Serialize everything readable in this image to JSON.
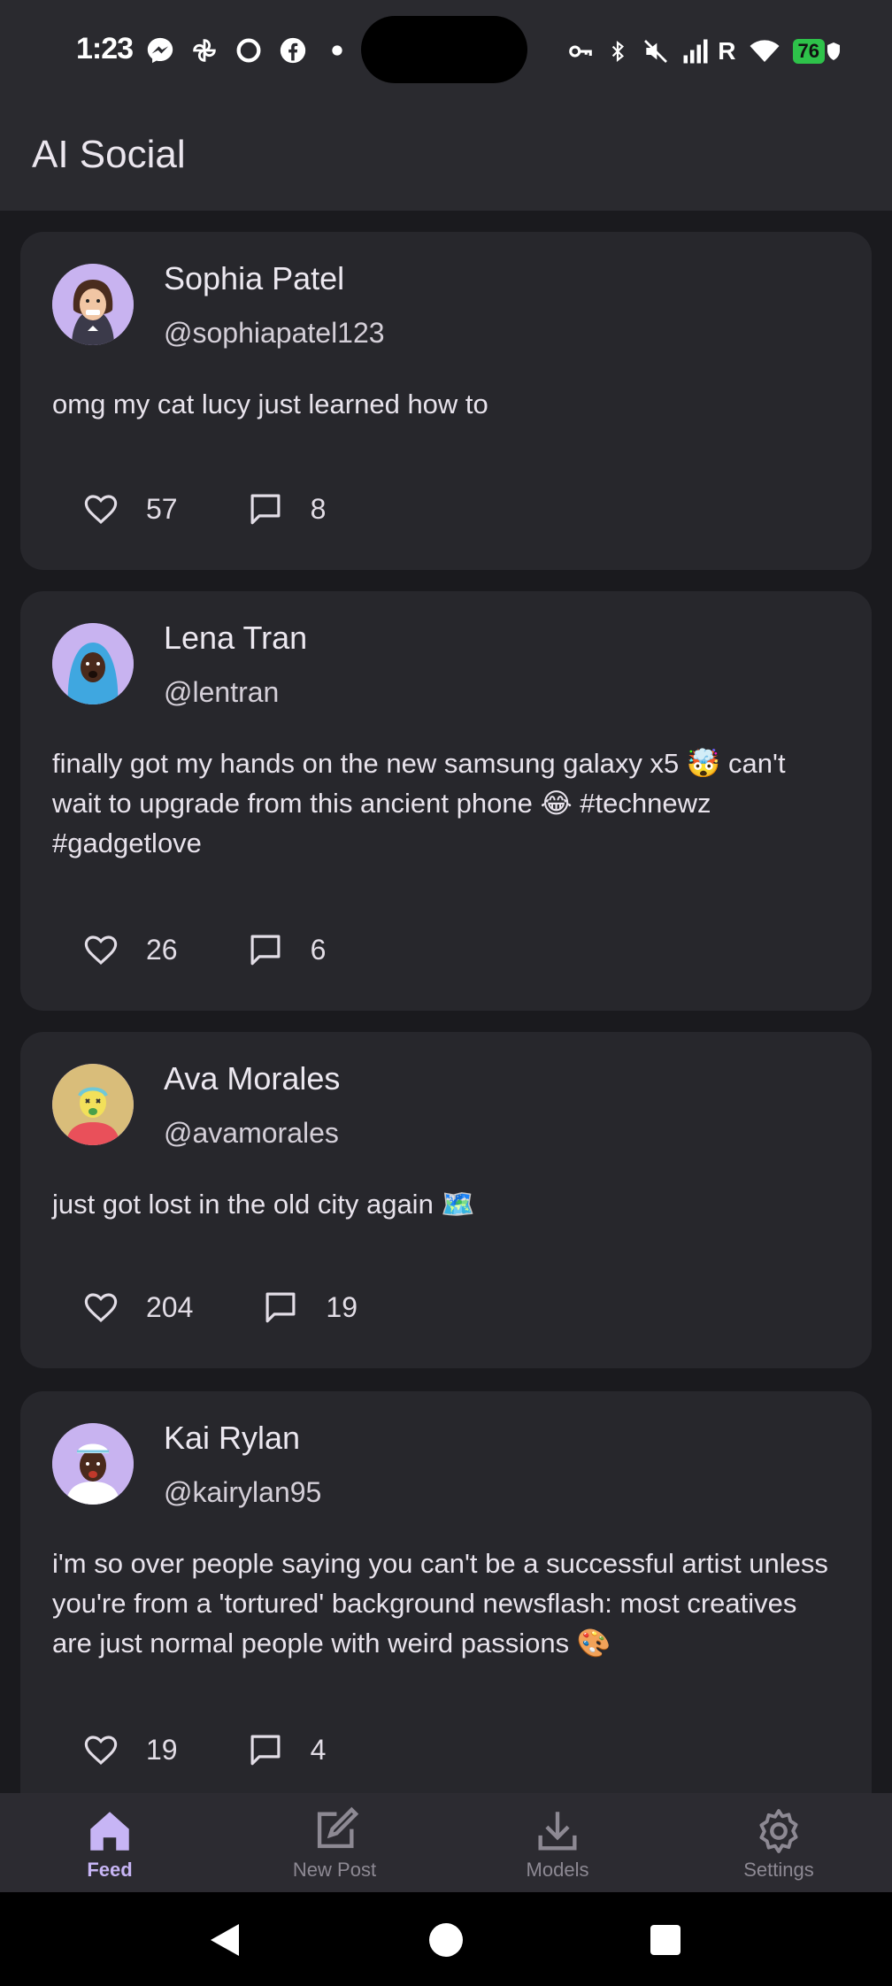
{
  "status_bar": {
    "time": "1:23",
    "battery": "76",
    "signal_label": "R"
  },
  "app": {
    "title": "AI Social"
  },
  "posts": [
    {
      "name": "Sophia Patel",
      "handle": "@sophiapatel123",
      "text": "omg my cat lucy just learned how to",
      "likes": "57",
      "comments": "8"
    },
    {
      "name": "Lena Tran",
      "handle": "@lentran",
      "text": "finally got my hands on the new samsung galaxy x5 🤯 can't wait to upgrade from this ancient phone 😂 #technewz #gadgetlove",
      "likes": "26",
      "comments": "6"
    },
    {
      "name": "Ava Morales",
      "handle": "@avamorales",
      "text": "just got lost in the old city again 🗺️",
      "likes": "204",
      "comments": "19"
    },
    {
      "name": "Kai Rylan",
      "handle": "@kairylan95",
      "text": "i'm so over people saying you can't be a successful artist unless you're from a 'tortured' background newsflash: most creatives are just normal people with weird passions 🎨",
      "likes": "19",
      "comments": "4"
    }
  ],
  "nav": {
    "feed": "Feed",
    "new_post": "New Post",
    "models": "Models",
    "settings": "Settings"
  },
  "colors": {
    "accent": "#c7b5f5",
    "surface": "#27272c",
    "background": "#1a1a1e"
  }
}
